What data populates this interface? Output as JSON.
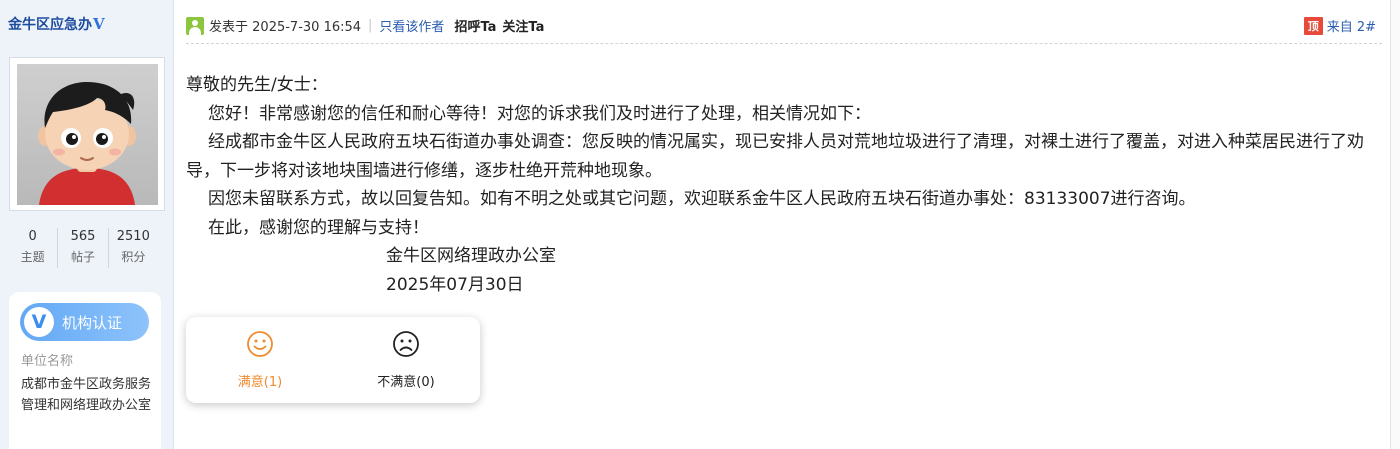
{
  "author": {
    "name": "金牛区应急办",
    "verified_mark": "V"
  },
  "stats": [
    {
      "value": "0",
      "label": "主题"
    },
    {
      "value": "565",
      "label": "帖子"
    },
    {
      "value": "2510",
      "label": "积分"
    }
  ],
  "certification": {
    "badge_label": "机构认证",
    "unit_title": "单位名称",
    "unit_name": "成都市金牛区政务服务管理和网络理政办公室"
  },
  "post_header": {
    "posted_prefix": "发表于",
    "posted_time": "2025-7-30 16:54",
    "separator": "|",
    "only_author": "只看该作者",
    "greet": "招呼Ta",
    "follow": "关注Ta",
    "floor_icon_text": "顶",
    "floor_label": "来自 2#"
  },
  "post_body": {
    "greeting": "尊敬的先生/女士：",
    "paragraphs": [
      "您好！非常感谢您的信任和耐心等待！对您的诉求我们及时进行了处理，相关情况如下：",
      "经成都市金牛区人民政府五块石街道办事处调查：您反映的情况属实，现已安排人员对荒地垃圾进行了清理，对裸土进行了覆盖，对进入种菜居民进行了劝导，下一步将对该地块围墙进行修缮，逐步杜绝开荒种地现象。",
      "因您未留联系方式，故以回复告知。如有不明之处或其它问题，欢迎联系金牛区人民政府五块石街道办事处：83133007进行咨询。",
      "在此，感谢您的理解与支持！"
    ],
    "signature": "金牛区网络理政办公室",
    "date": "2025年07月30日"
  },
  "rating": {
    "satisfied_label": "满意(1)",
    "unsatisfied_label": "不满意(0)"
  },
  "colors": {
    "accent_blue": "#2a5db0",
    "satisfied_orange": "#ef8b2c",
    "sidebar_bg": "#eef3fa",
    "cert_gradient_start": "#62a8f5"
  }
}
